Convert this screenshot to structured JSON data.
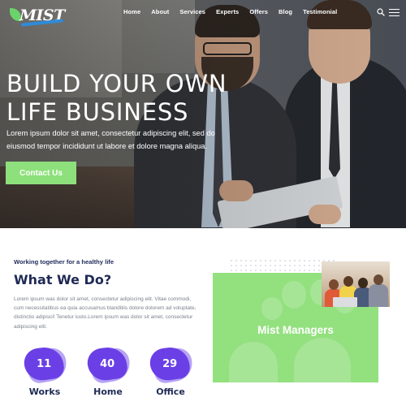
{
  "brand": {
    "logo_text": "MIST"
  },
  "nav": {
    "items": [
      "Home",
      "About",
      "Services",
      "Experts",
      "Offers",
      "Blog",
      "Testimonial"
    ]
  },
  "hero": {
    "title": "BUILD YOUR OWN LIFE BUSINESS",
    "text": "Lorem ipsum dolor sit amet, consectetur adipiscing elit, sed do eiusmod tempor incididunt ut labore et dolore magna aliqua.",
    "button_label": "Contact Us"
  },
  "about": {
    "tagline": "Working together for a healthy life",
    "title": "What We Do?",
    "text": "Lorem ipsum was dolor sit amet, consectetur adipiscing elit. Vitae commodi, cum necessitatibus ea quia accusamus blanditiis dolore dolorem ad voluptate, distinctio adipisci! Tenetur iusto.Lorem ipsum was dolor sit amet, consectetur adipiscing elit.",
    "stats": [
      {
        "value": "11",
        "label": "Works"
      },
      {
        "value": "40",
        "label": "Home"
      },
      {
        "value": "29",
        "label": "Office"
      }
    ],
    "card_title": "Mist Managers"
  },
  "colors": {
    "accent_green": "#8de07b",
    "accent_purple": "#6b3fe6",
    "heading_navy": "#1f2a56"
  },
  "icons": {
    "search": "search-icon",
    "menu": "hamburger-menu-icon"
  }
}
